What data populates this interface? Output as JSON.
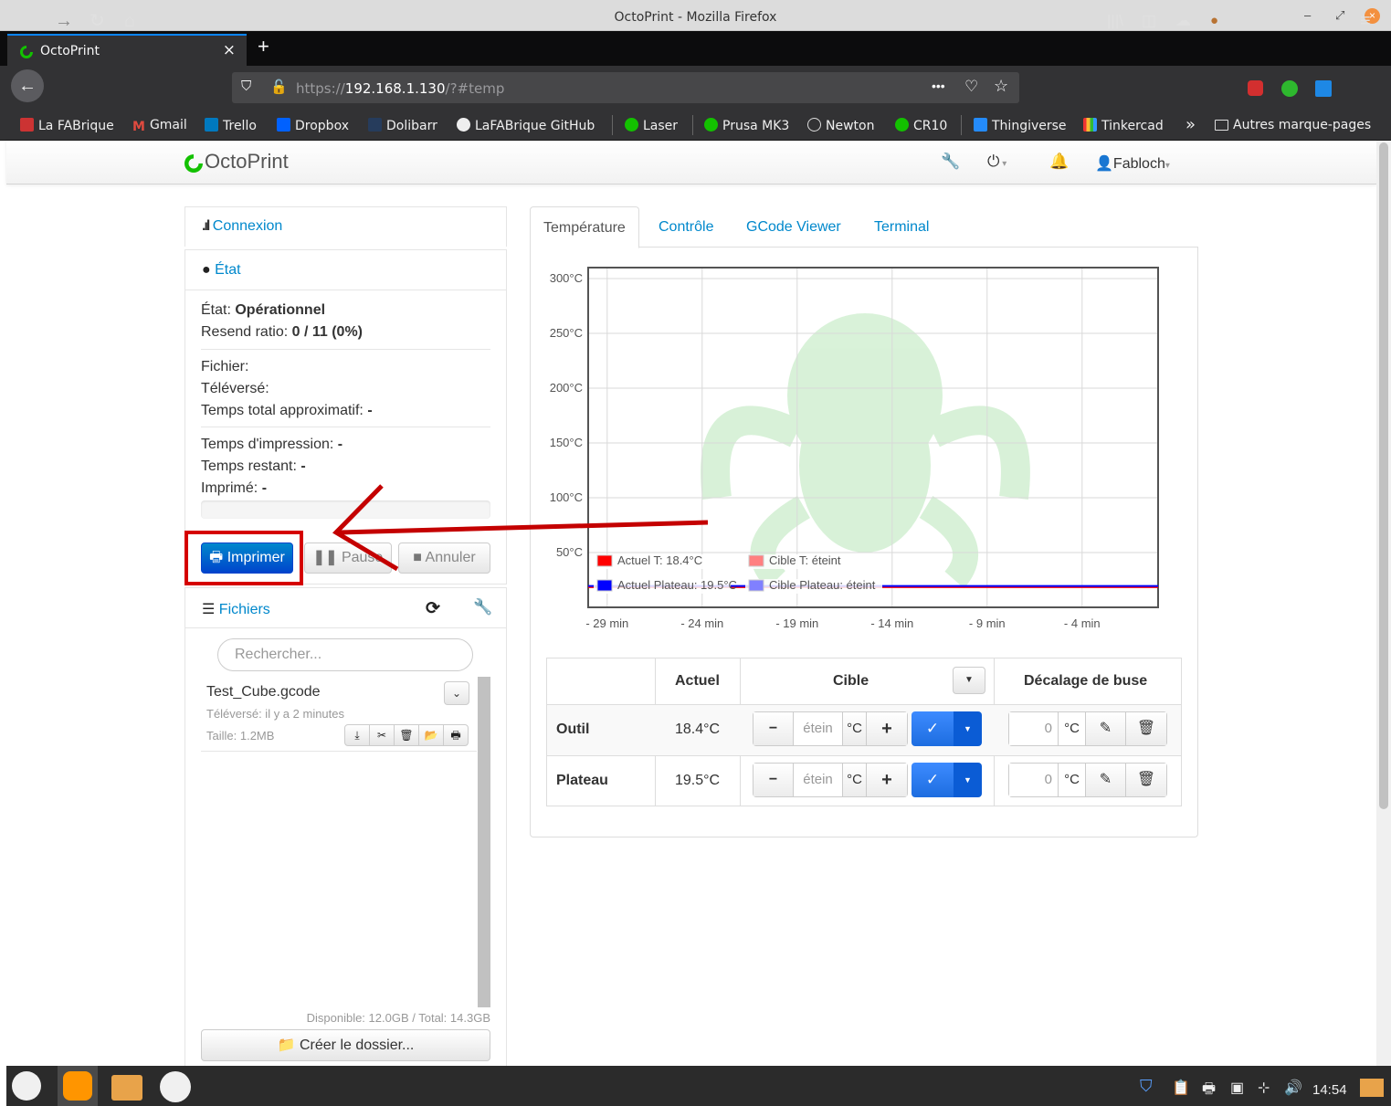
{
  "window": {
    "title": "OctoPrint - Mozilla Firefox",
    "min": "–",
    "restore": "⤢",
    "close": "⊗"
  },
  "browser": {
    "tab_title": "OctoPrint",
    "tab_close": "×",
    "new_tab": "+",
    "url_prefix": "https://",
    "url_host": "192.168.1.130",
    "url_path": "/?#temp",
    "url_more": "•••",
    "bookmarks": [
      "La FABrique",
      "Gmail",
      "Trello",
      "Dropbox",
      "Dolibarr",
      "LaFABrique GitHub",
      "Laser",
      "Prusa MK3",
      "Newton",
      "CR10",
      "Thingiverse",
      "Tinkercad",
      "Autres marque-pages"
    ],
    "overflow": "»"
  },
  "header": {
    "brand": "OctoPrint",
    "user": "Fabloch",
    "caret": "▾"
  },
  "connection": {
    "title": "Connexion"
  },
  "state": {
    "title": "État",
    "status_label": "État:",
    "status_value": "Opérationnel",
    "resend_label": "Resend ratio:",
    "resend_value": "0 / 11 (0%)",
    "file_label": "Fichier:",
    "uploaded_label": "Téléversé:",
    "total_time_label": "Temps total approximatif:",
    "total_time_value": "-",
    "print_time_label": "Temps d'impression:",
    "print_time_value": "-",
    "remaining_label": "Temps restant:",
    "remaining_value": "-",
    "printed_label": "Imprimé:",
    "printed_value": "-",
    "progress": 0,
    "btn_print": "Imprimer",
    "btn_pause": "Pause",
    "btn_cancel": "Annuler"
  },
  "files": {
    "title": "Fichiers",
    "search_placeholder": "Rechercher...",
    "items": [
      {
        "name": "Test_Cube.gcode",
        "uploaded": "Téléversé: il y a 2 minutes",
        "size": "Taille: 1.2MB"
      }
    ],
    "storage": "Disponible: 12.0GB / Total: 14.3GB",
    "create_folder": "Créer le dossier..."
  },
  "tabs": [
    "Température",
    "Contrôle",
    "GCode Viewer",
    "Terminal"
  ],
  "chart_data": {
    "type": "line",
    "title": "",
    "xlabel": "",
    "ylabel": "",
    "y_ticks": [
      "300°C",
      "250°C",
      "200°C",
      "150°C",
      "100°C",
      "50°C"
    ],
    "x_ticks": [
      "- 29 min",
      "- 24 min",
      "- 19 min",
      "- 14 min",
      "- 9 min",
      "- 4 min"
    ],
    "ylim": [
      0,
      310
    ],
    "xlim_min": [
      -30,
      0
    ],
    "grid": true,
    "legend_position": "bottom-left",
    "series": [
      {
        "name": "Actuel T: 18.4°C",
        "color": "#ff0000",
        "values": [
          18.4,
          18.4,
          18.4,
          18.4,
          18.4,
          18.4,
          18.4
        ]
      },
      {
        "name": "Cible T: éteint",
        "color": "#ff8080",
        "values": []
      },
      {
        "name": "Actuel Plateau: 19.5°C",
        "color": "#0000ff",
        "values": [
          19.5,
          19.5,
          19.5,
          19.5,
          19.5,
          19.5,
          19.5
        ]
      },
      {
        "name": "Cible Plateau: éteint",
        "color": "#8080ff",
        "values": []
      }
    ],
    "x": [
      -30,
      -25,
      -20,
      -15,
      -10,
      -5,
      0
    ]
  },
  "temp_table": {
    "headers": [
      "Actuel",
      "Cible",
      "Décalage de buse"
    ],
    "rows": [
      {
        "name": "Outil",
        "actual": "18.4°C",
        "target_placeholder": "étein",
        "unit": "°C",
        "offset": "0"
      },
      {
        "name": "Plateau",
        "actual": "19.5°C",
        "target_placeholder": "étein",
        "unit": "°C",
        "offset": "0"
      }
    ]
  },
  "taskbar": {
    "clock": "14:54"
  }
}
